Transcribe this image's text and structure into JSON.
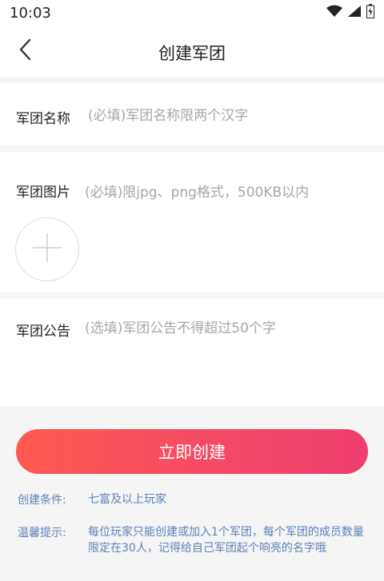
{
  "status_bar": {
    "time": "10:03",
    "icons": [
      "wifi-icon",
      "signal-icon",
      "battery-icon"
    ]
  },
  "header": {
    "title": "创建军团",
    "back_icon": "chevron-left-icon"
  },
  "form": {
    "name_label": "军团名称",
    "name_placeholder": "(必填)军团名称限两个汉字",
    "image_label": "军团图片",
    "image_hint": "(必填)限jpg、png格式，500KB以内",
    "upload_icon": "plus-icon",
    "notice_label": "军团公告",
    "notice_placeholder": "(选填)军团公告不得超过50个字"
  },
  "actions": {
    "create_label": "立即创建"
  },
  "info": {
    "condition_label": "创建条件:",
    "condition_value": "七富及以上玩家",
    "tips_label": "温馨提示:",
    "tips_value": "每位玩家只能创建或加入1个军团，每个军团的成员数量限定在30人，记得给自己军团起个响亮的名字哦"
  },
  "colors": {
    "accent_start": "#ff5a4f",
    "accent_end": "#ee3d6e",
    "info_text": "#5a7fb8",
    "background": "#f5f5f5"
  }
}
